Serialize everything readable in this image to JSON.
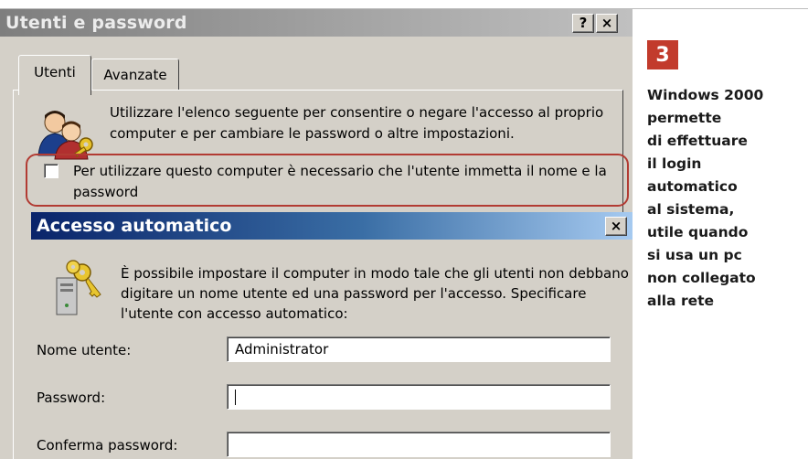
{
  "outer_dialog": {
    "title": "Utenti e password",
    "help_button": "?",
    "close_button": "×",
    "tabs": [
      {
        "label": "Utenti",
        "active": true
      },
      {
        "label": "Avanzate",
        "active": false
      }
    ],
    "intro_text": "Utilizzare l'elenco seguente per consentire o negare l'accesso al proprio computer e per cambiare le password o altre impostazioni.",
    "checkbox": {
      "label": "Per utilizzare questo computer è necessario che l'utente immetta il nome e la password",
      "checked": false
    }
  },
  "inner_dialog": {
    "title": "Accesso automatico",
    "close_button": "×",
    "description": "È possibile impostare il computer in modo tale che gli utenti non debbano digitare un nome utente ed una password per l'accesso. Specificare l'utente con accesso automatico:",
    "fields": [
      {
        "label": "Nome utente:",
        "value": "Administrator"
      },
      {
        "label": "Password:",
        "value": ""
      },
      {
        "label": "Conferma password:",
        "value": ""
      }
    ]
  },
  "caption": {
    "badge": "3",
    "text": "Windows 2000\npermette\ndi effettuare\nil login\nautomatico\nal sistema,\nutile quando\nsi usa un pc\nnon collegato\nalla rete"
  },
  "colors": {
    "highlight_border": "#b23b33",
    "badge_bg": "#c23b2c",
    "active_title_start": "#0a246a",
    "active_title_end": "#a6caf0",
    "dialog_face": "#d4d0c8"
  },
  "icons": {
    "users": "users-icon",
    "keys": "keys-icon"
  }
}
